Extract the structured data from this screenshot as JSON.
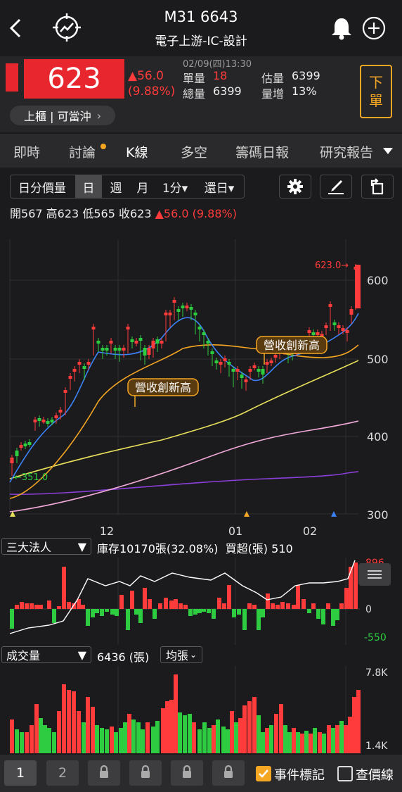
{
  "header": {
    "title": "M31 6643",
    "subtitle": "電子上游-IC-設計"
  },
  "quote": {
    "price": "623",
    "change": "▲56.0",
    "change_pct": "(9.88%)",
    "datetime": "02/09(四)13:30",
    "unit_vol_label": "單量",
    "unit_vol": "18",
    "total_vol_label": "總量",
    "total_vol": "6399",
    "est_vol_label": "估量",
    "est_vol": "6399",
    "vol_inc_label": "量增",
    "vol_inc": "13%",
    "market_pill": "上櫃 | 可當沖",
    "market_pill_chevron": "›",
    "order_button": "下單"
  },
  "tabs": [
    "即時",
    "討論",
    "K線",
    "多空",
    "籌碼日報",
    "研究報告"
  ],
  "active_tab": "K線",
  "toolbar": {
    "segments": [
      "日分價量",
      "日",
      "週",
      "月",
      "1分▾",
      "還日▾"
    ],
    "active_segment": "日"
  },
  "ohlc": {
    "open_label": "開",
    "open": "567",
    "high_label": "高",
    "high": "623",
    "low_label": "低",
    "low": "565",
    "close_label": "收",
    "close": "623",
    "change": "▲56.0 (9.88%)"
  },
  "main_chart": {
    "y_ticks": [
      "600",
      "500",
      "400",
      "300"
    ],
    "x_ticks": [
      "12",
      "01",
      "02"
    ],
    "high_marker": "623.0→",
    "low_marker": "←351.0",
    "event_label": "營收創新高"
  },
  "institutional": {
    "dropdown": "三大法人",
    "summary": "庫存10170張(32.08%)  買超(張) 510",
    "y_max": "896",
    "y_zero": "0",
    "y_min": "-550"
  },
  "volume": {
    "dropdown": "成交量",
    "value": "6436 (張)",
    "avg_dropdown": "均張",
    "y_max": "7.8K",
    "y_min": "1.4K"
  },
  "bottom": {
    "tab1": "1",
    "tab2": "2",
    "event_mark_label": "事件標記",
    "price_line_label": "查價線"
  },
  "colors": {
    "up": "#ff3b3b",
    "down": "#2ecc40",
    "accent": "#f5a623",
    "ma5": "#3b82f6",
    "ma10": "#f5a623",
    "ma20": "#e8e05a",
    "ma60": "#f0a8d8",
    "ma120": "#8b3fd9"
  }
}
